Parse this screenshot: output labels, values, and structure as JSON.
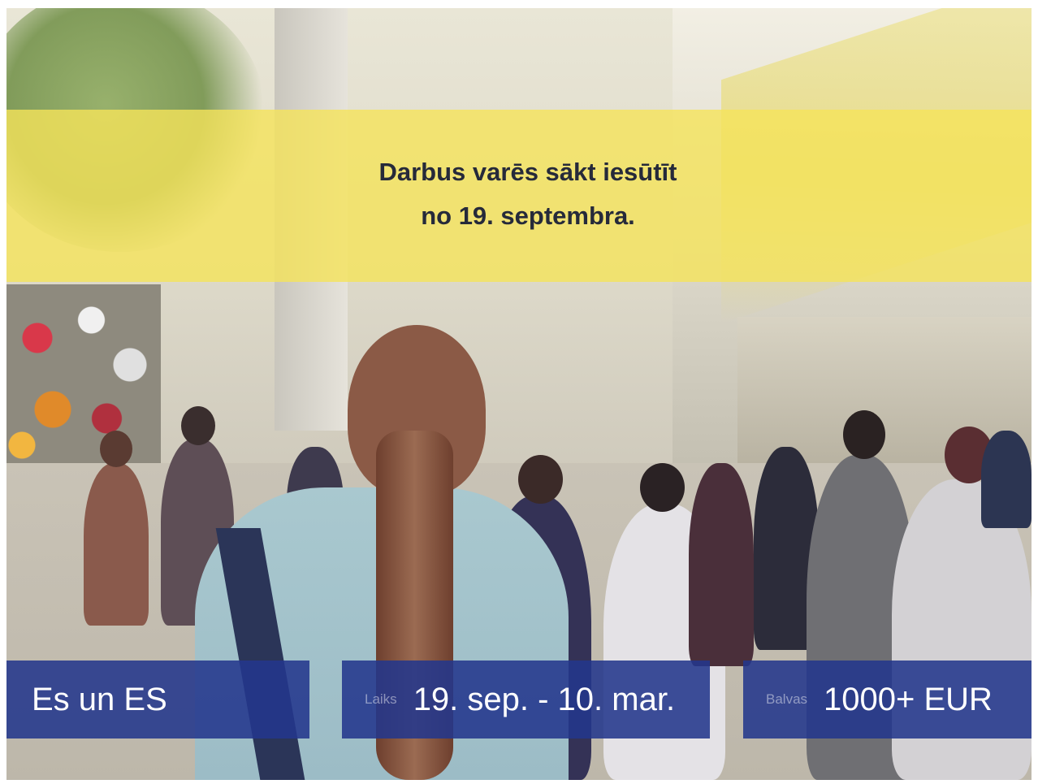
{
  "banner": {
    "line1": "Darbus varēs sākt iesūtīt",
    "line2": "no 19. septembra."
  },
  "info_boxes": [
    {
      "label": "",
      "value": "Es un ES"
    },
    {
      "label": "Laiks",
      "value": "19. sep. - 10. mar."
    },
    {
      "label": "Balvas",
      "value": "1000+ EUR"
    }
  ],
  "colors": {
    "banner_yellow": "#f5e45a",
    "box_blue": "#23378c",
    "banner_text": "#262a3a"
  }
}
